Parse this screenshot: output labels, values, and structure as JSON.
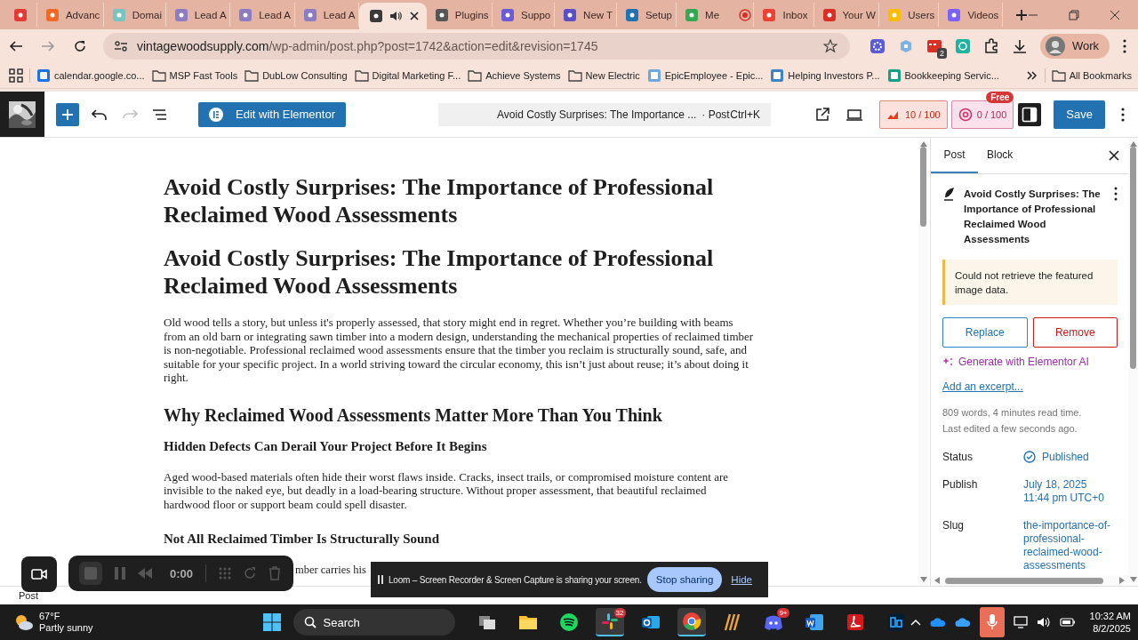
{
  "browser": {
    "tabs": [
      {
        "color": "#e53935",
        "selected": false,
        "audio": false,
        "recording": false
      },
      {
        "label": "Advanc",
        "color": "#f06a25",
        "selected": false,
        "audio": false,
        "recording": false
      },
      {
        "label": "Domai",
        "color": "#7ac4c0",
        "selected": false,
        "audio": false,
        "recording": false
      },
      {
        "label": "Lead A",
        "color": "#8e7cc3",
        "selected": false,
        "audio": false,
        "recording": false
      },
      {
        "label": "Lead A",
        "color": "#8e7cc3",
        "selected": false,
        "audio": false,
        "recording": false
      },
      {
        "label": "Lead A",
        "color": "#8e7cc3",
        "selected": false,
        "audio": false,
        "recording": false
      },
      {
        "color": "#3a3a3a",
        "selected": true,
        "audio": true,
        "recording": false
      },
      {
        "label": "Plugins",
        "color": "#555555",
        "selected": false,
        "audio": false,
        "recording": false
      },
      {
        "label": "Suppo",
        "color": "#6b5bd6",
        "selected": false,
        "audio": false,
        "recording": false
      },
      {
        "label": "New T",
        "color": "#5b4fc4",
        "selected": false,
        "audio": false,
        "recording": false
      },
      {
        "label": "Setup",
        "color": "#2271b1",
        "selected": false,
        "audio": false,
        "recording": false
      },
      {
        "label": "Me",
        "color": "#34a853",
        "selected": false,
        "audio": false,
        "recording": true
      },
      {
        "label": "Inbox",
        "color": "#ea4335",
        "selected": false,
        "audio": false,
        "recording": false
      },
      {
        "label": "Your W",
        "color": "#d93025",
        "selected": false,
        "audio": false,
        "recording": false
      },
      {
        "label": "Users",
        "color": "#fbbc04",
        "selected": false,
        "audio": false,
        "recording": false
      },
      {
        "label": "Videos",
        "color": "#7b61ff",
        "selected": false,
        "audio": false,
        "recording": false
      }
    ],
    "url_host": "vintagewoodsupply.com",
    "url_path": "/wp-admin/post.php?post=1742&action=edit&revision=1745",
    "extension_badge": "2",
    "profile": "Work",
    "bookmarks": [
      {
        "kind": "site",
        "label": "calendar.google.co..."
      },
      {
        "kind": "folder",
        "label": "MSP Fast Tools"
      },
      {
        "kind": "folder",
        "label": "DubLow Consulting"
      },
      {
        "kind": "folder",
        "label": "Digital Marketing F..."
      },
      {
        "kind": "folder",
        "label": "Achieve Systems"
      },
      {
        "kind": "folder",
        "label": "New Electric"
      },
      {
        "kind": "site",
        "label": "EpicEmployee - Epic..."
      },
      {
        "kind": "site",
        "label": "Helping Investors P..."
      },
      {
        "kind": "site",
        "label": "Bookkeeping Servic..."
      }
    ],
    "all_bookmarks": "All Bookmarks"
  },
  "editor": {
    "toolbar": {
      "elementor_button": "Edit with Elementor",
      "command_title": "Avoid Costly Surprises: The Importance ...",
      "command_type": "· Post",
      "shortcut": "Ctrl+K",
      "redo_disabled": true,
      "seo_score": "10 / 100",
      "ai_score": "0 / 100",
      "free_badge": "Free",
      "sidebar_open": true,
      "save": "Save"
    },
    "blocks": [
      {
        "kind": "title",
        "text": "Avoid Costly Surprises: The Importance of Professional Reclaimed Wood Assessments"
      },
      {
        "kind": "title",
        "text": "Avoid Costly Surprises: The Importance of Professional Reclaimed Wood Assessments"
      },
      {
        "kind": "paragraph",
        "text": "Old wood tells a story, but unless it's properly assessed, that story might end in regret. Whether you’re building with beams from an old barn or integrating sawn timber into a modern design, understanding the mechanical properties of reclaimed timber is non-negotiable. Professional reclaimed wood assessments ensure that the timber you reclaim is structurally sound, safe, and suitable for your specific project. In a world striving toward the circular economy, this isn’t just about reuse; it’s about doing it right."
      },
      {
        "kind": "heading2",
        "text": "Why Reclaimed Wood Assessments Matter More Than You Think"
      },
      {
        "kind": "heading3",
        "text": "Hidden Defects Can Derail Your Project Before It Begins"
      },
      {
        "kind": "paragraph",
        "text": "Aged wood-based materials often hide their worst flaws inside. Cracks, insect trails, or compromised moisture content are invisible to the naked eye, but deadly in a load-bearing structure. Without proper assessment, that beautiful reclaimed hardwood floor or support beam could spell disaster."
      },
      {
        "kind": "heading3",
        "text": "Not All Reclaimed Timber Is Structurally Sound"
      },
      {
        "kind": "fragment",
        "text": "mber carries his"
      }
    ],
    "breadcrumb": "Post",
    "sidebar": {
      "tabs": [
        {
          "label": "Post",
          "selected": true
        },
        {
          "label": "Block",
          "selected": false
        }
      ],
      "title": "Avoid Costly Surprises: The Importance of Professional Reclaimed Wood Assessments",
      "notice": "Could not retrieve the featured image data.",
      "replace": "Replace",
      "remove": "Remove",
      "ai_link": "Generate with Elementor AI",
      "excerpt_link": "Add an excerpt...",
      "stats": [
        "809 words, 4 minutes read time.",
        "Last edited a few seconds ago."
      ],
      "fields": [
        {
          "kind": "status",
          "label": "Status",
          "lines": [
            "Published"
          ]
        },
        {
          "kind": "link",
          "label": "Publish",
          "lines": [
            "July 18, 2025",
            "11:44 pm UTC+0"
          ]
        },
        {
          "kind": "link",
          "label": "Slug",
          "lines": [
            "the-importance-of-professional-reclaimed-wood-assessments"
          ]
        }
      ]
    }
  },
  "loom": {
    "time": "0:00",
    "message": "Loom – Screen Recorder & Screen Capture is sharing your screen.",
    "stop": "Stop sharing",
    "hide": "Hide"
  },
  "taskbar": {
    "temperature": "67°F",
    "weather": "Partly sunny",
    "search": "Search",
    "apps": [
      {
        "kind": "taskview",
        "active": false
      },
      {
        "kind": "explorer",
        "active": false
      },
      {
        "kind": "spotify",
        "active": false
      },
      {
        "kind": "slack",
        "active": true,
        "badge": "32"
      },
      {
        "kind": "outlook",
        "active": false
      },
      {
        "kind": "chrome",
        "active": true
      },
      {
        "kind": "bars",
        "active": false
      },
      {
        "kind": "discord",
        "active": false,
        "badge": "9+"
      },
      {
        "kind": "word",
        "active": false
      },
      {
        "kind": "acrobat",
        "active": false
      },
      {
        "kind": "photoshop",
        "active": false
      }
    ],
    "mic_on": true,
    "time": "10:32 AM",
    "date": "8/2/2025"
  }
}
